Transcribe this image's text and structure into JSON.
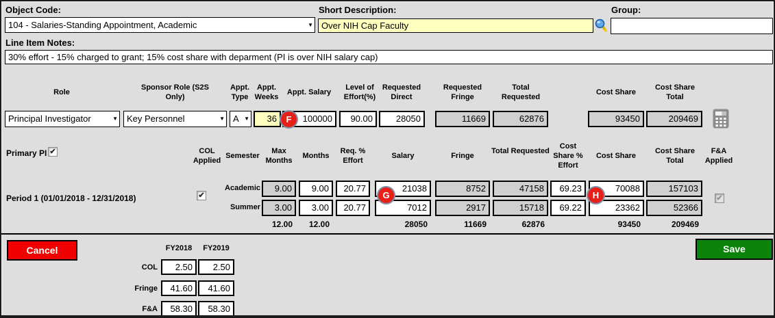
{
  "form": {
    "object_code": {
      "label": "Object Code:",
      "value": "104 - Salaries-Standing Appointment, Academic"
    },
    "short_description": {
      "label": "Short Description:",
      "value": "Over NIH Cap Faculty"
    },
    "group": {
      "label": "Group:",
      "value": ""
    },
    "line_item_notes": {
      "label": "Line Item Notes:",
      "value": "30% effort - 15% charged to grant; 15% cost share with deparment (PI is over NIH salary cap)"
    }
  },
  "person_table": {
    "headers": {
      "role": "Role",
      "sponsor_role": "Sponsor Role (S2S Only)",
      "appt_type": "Appt. Type",
      "appt_weeks": "Appt. Weeks",
      "appt_salary": "Appt. Salary",
      "level_of_effort": "Level of Effort(%)",
      "requested_direct": "Requested Direct",
      "requested_fringe": "Requested Fringe",
      "total_requested": "Total Requested",
      "cost_share": "Cost Share",
      "cost_share_total": "Cost Share Total"
    },
    "row": {
      "role": "Principal Investigator",
      "sponsor_role": "Key Personnel",
      "appt_type": "A",
      "appt_weeks": "36",
      "appt_salary": "100000",
      "level_of_effort": "90.00",
      "requested_direct": "28050",
      "requested_fringe": "11669",
      "total_requested": "62876",
      "cost_share": "93450",
      "cost_share_total": "209469"
    },
    "marker": "F"
  },
  "primary_pi": {
    "label": "Primary PI",
    "checked": true
  },
  "period_table": {
    "headers": {
      "col_applied": "COL Applied",
      "semester": "Semester",
      "max_months": "Max Months",
      "months": "Months",
      "req_effort": "Req. % Effort",
      "salary": "Salary",
      "fringe": "Fringe",
      "total_requested": "Total Requested",
      "cost_share_effort": "Cost Share % Effort",
      "cost_share": "Cost Share",
      "cost_share_total": "Cost Share Total",
      "fa_applied": "F&A Applied"
    },
    "period_label": "Period 1 (01/01/2018 - 12/31/2018)",
    "markers": {
      "g": "G",
      "h": "H"
    },
    "rows": [
      {
        "semester": "Academic",
        "max_months": "9.00",
        "months": "9.00",
        "req_effort": "20.77",
        "salary": "21038",
        "fringe": "8752",
        "total_requested": "47158",
        "cost_share_effort": "69.23",
        "cost_share": "70088",
        "cost_share_total": "157103"
      },
      {
        "semester": "Summer",
        "max_months": "3.00",
        "months": "3.00",
        "req_effort": "20.77",
        "salary": "7012",
        "fringe": "2917",
        "total_requested": "15718",
        "cost_share_effort": "69.22",
        "cost_share": "23362",
        "cost_share_total": "52366"
      }
    ],
    "totals": {
      "max_months": "12.00",
      "months": "12.00",
      "salary": "28050",
      "fringe": "11669",
      "total_requested": "62876",
      "cost_share": "93450",
      "cost_share_total": "209469"
    }
  },
  "footer": {
    "cancel": "Cancel",
    "save": "Save",
    "fy_headers": [
      "FY2018",
      "FY2019"
    ],
    "rates": [
      {
        "label": "COL",
        "values": [
          "2.50",
          "2.50"
        ]
      },
      {
        "label": "Fringe",
        "values": [
          "41.60",
          "41.60"
        ]
      },
      {
        "label": "F&A",
        "values": [
          "58.30",
          "58.30"
        ]
      }
    ]
  },
  "icons": {
    "dropdown_caret": "▼",
    "checkmark": "✔"
  },
  "colors": {
    "panel_bg": "#dedede",
    "highlight_yellow": "#ffffc0",
    "readonly_grey": "#d0d0d0",
    "marker_red": "#e8201a",
    "cancel_red": "#f00000",
    "save_green": "#0c840c"
  }
}
